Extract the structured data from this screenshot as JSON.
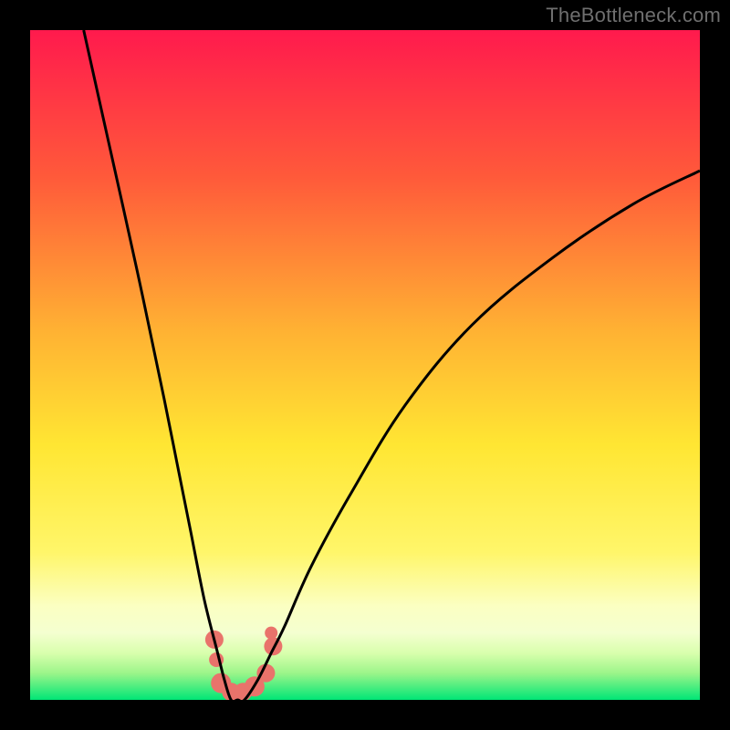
{
  "watermark": "TheBottleneck.com",
  "chart_data": {
    "type": "line",
    "title": "",
    "xlabel": "",
    "ylabel": "",
    "xlim": [
      0,
      100
    ],
    "ylim": [
      0,
      100
    ],
    "background_gradient": {
      "top": "#ff1a4d",
      "mid_upper": "#ff7a33",
      "mid": "#ffe633",
      "mid_lower": "#f8ffbf",
      "band": "#d4ff99",
      "bottom": "#00e676"
    },
    "series": [
      {
        "name": "bottleneck-curve",
        "x": [
          8,
          12,
          16,
          20,
          22,
          24,
          26,
          28,
          29,
          30,
          31,
          32,
          34,
          36,
          38,
          42,
          48,
          56,
          66,
          78,
          90,
          100
        ],
        "y": [
          100,
          82,
          64,
          45,
          35,
          25,
          15,
          7,
          3,
          0,
          0,
          0,
          3,
          7,
          11,
          20,
          31,
          44,
          56,
          66,
          74,
          79
        ]
      }
    ],
    "markers": {
      "name": "highlight-points",
      "color": "#e9736b",
      "points": [
        {
          "x": 27.5,
          "y": 9,
          "r": 10
        },
        {
          "x": 27.8,
          "y": 6,
          "r": 8
        },
        {
          "x": 28.5,
          "y": 2.5,
          "r": 11
        },
        {
          "x": 30.0,
          "y": 1.2,
          "r": 10
        },
        {
          "x": 31.8,
          "y": 1.2,
          "r": 10
        },
        {
          "x": 33.5,
          "y": 2.0,
          "r": 11
        },
        {
          "x": 35.2,
          "y": 4.0,
          "r": 10
        },
        {
          "x": 36.3,
          "y": 8.0,
          "r": 10
        },
        {
          "x": 36.0,
          "y": 10.0,
          "r": 7
        }
      ]
    }
  }
}
